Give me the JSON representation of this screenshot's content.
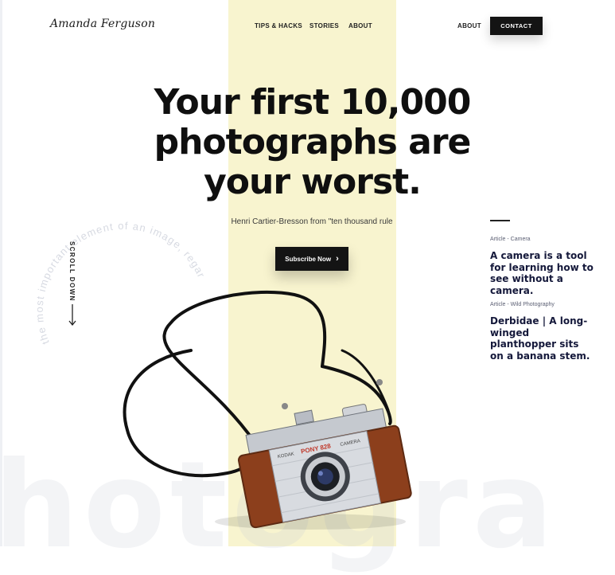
{
  "header": {
    "logo": "Amanda Ferguson",
    "nav": [
      "TIPS & HACKS",
      "STORIES",
      "ABOUT"
    ],
    "right_nav": "ABOUT",
    "contact": "CONTACT"
  },
  "hero": {
    "headline": [
      "Your first 10,000",
      "photographs are",
      "your worst."
    ],
    "quote": "Henri Cartier-Bresson from \"ten thousand rule",
    "subscribe": "Subscribe Now",
    "circle_text": "the most important element of an image, regardless of th"
  },
  "scroll": {
    "label": "SCROLL DOWN"
  },
  "articles": [
    {
      "category": "Article - Camera",
      "title": "A camera is a tool for learning how to see without a camera."
    },
    {
      "category": "Article - Wild Photography",
      "title": "Derbidae | A long-winged planthopper sits on a banana stem."
    }
  ],
  "camera": {
    "brand": "PONY 828",
    "maker": "KODAK",
    "type": "CAMERA"
  },
  "background": {
    "word": "hotogra"
  },
  "colors": {
    "accent_stripe": "#f8f4cf",
    "button": "#141414",
    "leather": "#8c3f1c"
  },
  "icons": {
    "subscribe": "chevron-right-icon",
    "scroll": "arrow-down-icon"
  }
}
